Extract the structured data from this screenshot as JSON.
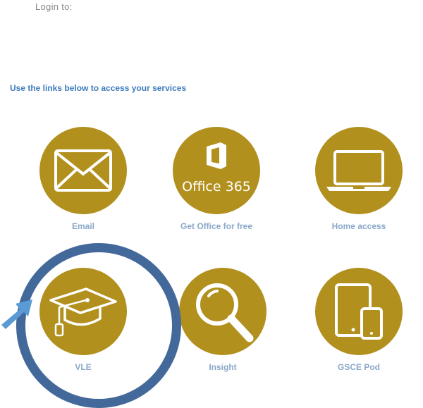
{
  "header": {
    "login_text": "Login to:"
  },
  "intro": {
    "text": "Use the links below to access your services"
  },
  "tiles": [
    {
      "label": "Email",
      "icon": "envelope-icon"
    },
    {
      "label": "Get Office for free",
      "icon": "office-365-icon",
      "icon_text": "Office 365"
    },
    {
      "label": "Home access",
      "icon": "laptop-icon"
    },
    {
      "label": "VLE",
      "icon": "graduation-cap-icon"
    },
    {
      "label": "Insight",
      "icon": "magnifier-icon"
    },
    {
      "label": "GSCE Pod",
      "icon": "tablet-phone-icon"
    }
  ],
  "colors": {
    "tile_gold": "#b1901e",
    "intro_blue": "#3d7bbd",
    "highlight_ring": "#43699a",
    "arrow_blue": "#5b9bd5"
  }
}
